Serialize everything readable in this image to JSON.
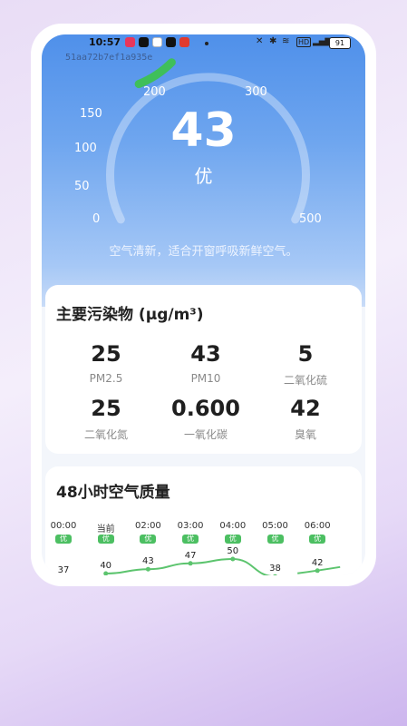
{
  "status": {
    "time": "10:57",
    "app_icons": [
      "music-app-icon",
      "tiktok-icon",
      "photos-app-icon",
      "tiktok-icon",
      "red-app-icon"
    ],
    "battery": "91"
  },
  "device_id": "51aa72b7ef1a935e",
  "gauge": {
    "ticks": [
      "0",
      "50",
      "100",
      "150",
      "200",
      "300",
      "500"
    ],
    "value": "43",
    "level": "优",
    "fraction": 0.086,
    "accent_color": "#3fbf5a"
  },
  "advice": "空气清新，适合开窗呼吸新鲜空气。",
  "pollutants": {
    "title": "主要污染物 (μg/m³)",
    "items": [
      {
        "value": "25",
        "label": "PM2.5"
      },
      {
        "value": "43",
        "label": "PM10"
      },
      {
        "value": "5",
        "label": "二氧化硫"
      },
      {
        "value": "25",
        "label": "二氧化氮"
      },
      {
        "value": "0.600",
        "label": "一氧化碳"
      },
      {
        "value": "42",
        "label": "臭氧"
      }
    ]
  },
  "hourly": {
    "title": "48小时空气质量",
    "hours": [
      {
        "time": "00:00",
        "level": "优",
        "value": "37"
      },
      {
        "time": "当前",
        "level": "优",
        "value": "40"
      },
      {
        "time": "02:00",
        "level": "优",
        "value": "43"
      },
      {
        "time": "03:00",
        "level": "优",
        "value": "47"
      },
      {
        "time": "04:00",
        "level": "优",
        "value": "50"
      },
      {
        "time": "05:00",
        "level": "优",
        "value": "38"
      },
      {
        "time": "06:00",
        "level": "优",
        "value": "42"
      }
    ],
    "line_color": "#5cc46e"
  }
}
